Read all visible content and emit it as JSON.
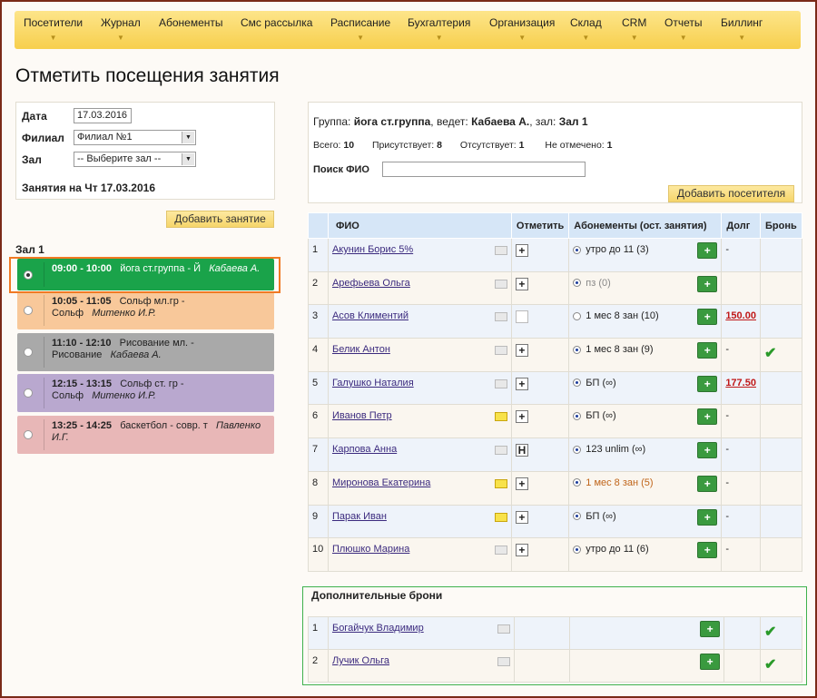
{
  "menu": [
    "Посетители",
    "Журнал",
    "Абонементы",
    "Смс рассылка",
    "Расписание",
    "Бухгалтерия",
    "Организация",
    "Склад",
    "CRM",
    "Отчеты",
    "Биллинг"
  ],
  "page_title": "Отметить посещения занятия",
  "filters": {
    "date_label": "Дата",
    "date_value": "17.03.2016",
    "branch_label": "Филиал",
    "branch_value": "Филиал №1",
    "hall_label": "Зал",
    "hall_value": "-- Выберите зал --",
    "lessons_title": "Занятия на Чт 17.03.2016"
  },
  "add_lesson_button": "Добавить занятие",
  "hall_name": "Зал 1",
  "lessons": [
    {
      "time": "09:00 - 10:00",
      "name": "йога ст.группа - Й",
      "teacher": "Кабаева А.",
      "color": "#1aa34a",
      "text_color": "#ffffff",
      "selected": true
    },
    {
      "time": "10:05 - 11:05",
      "name": "Сольф мл.гр - Сольф",
      "teacher": "Митенко И.Р.",
      "color": "#f8c89a",
      "text_color": "#222222",
      "selected": false
    },
    {
      "time": "11:10 - 12:10",
      "name": "Рисование мл. - Рисование",
      "teacher": "Кабаева А.",
      "color": "#a9a9a9",
      "text_color": "#222222",
      "selected": false
    },
    {
      "time": "12:15 - 13:15",
      "name": "Сольф ст. гр - Сольф",
      "teacher": "Митенко И.Р.",
      "color": "#b9a8cf",
      "text_color": "#222222",
      "selected": false
    },
    {
      "time": "13:25 - 14:25",
      "name": "баскетбол - совр. т",
      "teacher": "Павленко И.Г.",
      "color": "#e8b7b7",
      "text_color": "#222222",
      "selected": false
    }
  ],
  "group_info": {
    "prefix": "Группа:",
    "group": "йога ст.группа",
    "lead_label": ", ведет:",
    "teacher": "Кабаева А.",
    "hall_label": ", зал:",
    "hall": "Зал 1"
  },
  "stats": {
    "total_label": "Всего:",
    "total": "10",
    "present_label": "Присутствует:",
    "present": "8",
    "absent_label": "Отсутствует:",
    "absent": "1",
    "unmarked_label": "Не отмечено:",
    "unmarked": "1"
  },
  "search": {
    "label": "Поиск ФИО",
    "value": ""
  },
  "add_visitor_button": "Добавить посетителя",
  "table_headers": [
    "",
    "ФИО",
    "Отметить",
    "Абонементы (ост. занятия)",
    "Долг",
    "Бронь"
  ],
  "rows": [
    {
      "n": "1",
      "fio": "Акунин Борис 5%",
      "note": "grey",
      "mark": "+",
      "sub_checked": true,
      "sub": "утро до 11 (3)",
      "sub_color": "#222222",
      "debt": "-",
      "debt_red": false,
      "booked": false
    },
    {
      "n": "2",
      "fio": "Арефьева Ольга",
      "note": "grey",
      "mark": "+",
      "sub_checked": true,
      "sub": "пз (0)",
      "sub_color": "#888888",
      "debt": "",
      "debt_red": false,
      "booked": false
    },
    {
      "n": "3",
      "fio": "Асов Климентий",
      "note": "grey",
      "mark": "",
      "sub_checked": false,
      "sub": "1 мес 8 зан (10)",
      "sub_color": "#222222",
      "debt": "150.00",
      "debt_red": true,
      "booked": false
    },
    {
      "n": "4",
      "fio": "Белик Антон",
      "note": "grey",
      "mark": "+",
      "sub_checked": true,
      "sub": "1 мес 8 зан (9)",
      "sub_color": "#222222",
      "debt": "-",
      "debt_red": false,
      "booked": true
    },
    {
      "n": "5",
      "fio": "Галушко Наталия",
      "note": "grey",
      "mark": "+",
      "sub_checked": true,
      "sub": "БП (∞)",
      "sub_color": "#222222",
      "debt": "177.50",
      "debt_red": true,
      "booked": false
    },
    {
      "n": "6",
      "fio": "Иванов Петр",
      "note": "yellow",
      "mark": "+",
      "sub_checked": true,
      "sub": "БП (∞)",
      "sub_color": "#222222",
      "debt": "-",
      "debt_red": false,
      "booked": false
    },
    {
      "n": "7",
      "fio": "Карпова Анна",
      "note": "grey",
      "mark": "Н",
      "sub_checked": true,
      "sub": "123 unlim (∞)",
      "sub_color": "#222222",
      "debt": "-",
      "debt_red": false,
      "booked": false
    },
    {
      "n": "8",
      "fio": "Миронова Екатерина",
      "note": "yellow",
      "mark": "+",
      "sub_checked": true,
      "sub": "1 мес 8 зан (5)",
      "sub_color": "#c0651a",
      "debt": "-",
      "debt_red": false,
      "booked": false
    },
    {
      "n": "9",
      "fio": "Парак Иван",
      "note": "yellow",
      "mark": "+",
      "sub_checked": true,
      "sub": "БП (∞)",
      "sub_color": "#222222",
      "debt": "-",
      "debt_red": false,
      "booked": false
    },
    {
      "n": "10",
      "fio": "Плюшко Марина",
      "note": "grey",
      "mark": "+",
      "sub_checked": true,
      "sub": "утро до 11 (6)",
      "sub_color": "#222222",
      "debt": "-",
      "debt_red": false,
      "booked": false
    }
  ],
  "extra_title": "Дополнительные брони",
  "extra_rows": [
    {
      "n": "1",
      "fio": "Богайчук Владимир",
      "booked": true
    },
    {
      "n": "2",
      "fio": "Лучик Ольга",
      "booked": true
    }
  ],
  "icons": {
    "sub_icon": "add-user-card-icon",
    "check": "check-icon",
    "note": "note-icon"
  }
}
